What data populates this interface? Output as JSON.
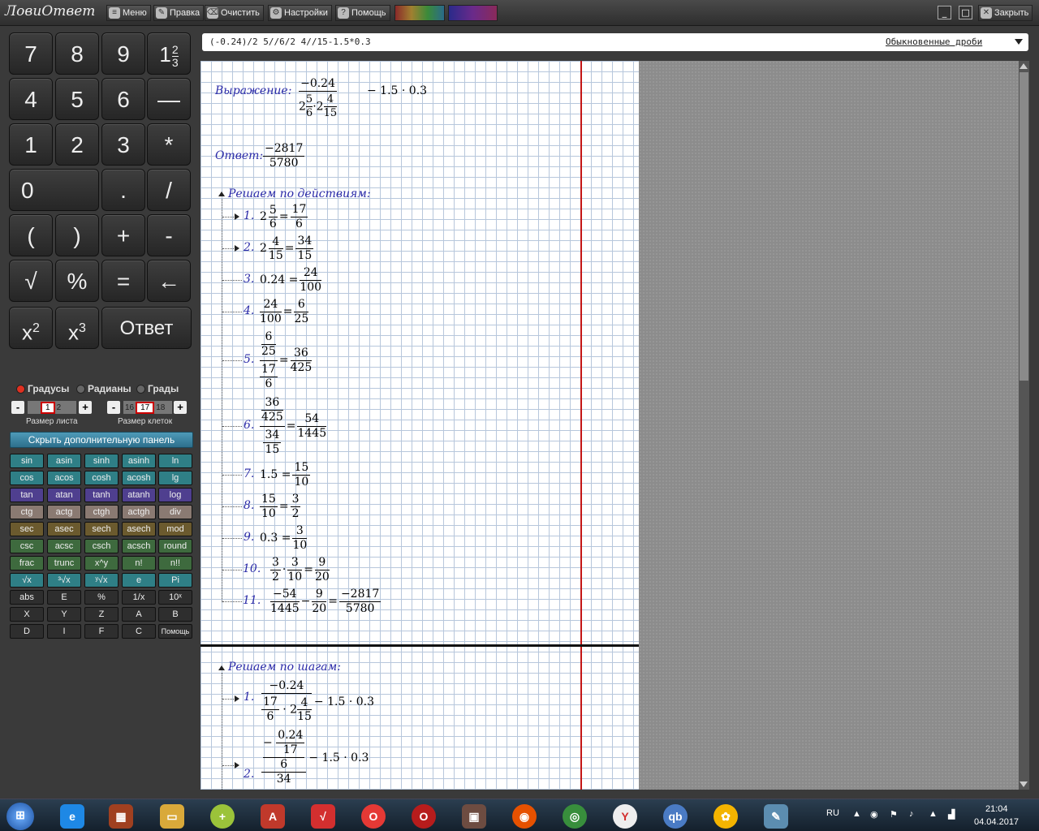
{
  "app": {
    "logo": "ЛовиОтвет",
    "menu": "Меню",
    "edit": "Правка",
    "clear": "Очистить",
    "settings": "Настройки",
    "help": "Помощь",
    "close": "Закрыть"
  },
  "keys": [
    "7",
    "8",
    "9",
    "4",
    "5",
    "6",
    "—",
    "1",
    "2",
    "3",
    "*",
    "0",
    ".",
    "/",
    "(",
    ")",
    "+",
    "-",
    "√",
    "%",
    "=",
    "←",
    "Ответ"
  ],
  "mixed_key": {
    "whole": "1",
    "num": "2",
    "den": "3"
  },
  "pow_keys": [
    {
      "base": "x",
      "exp": "2"
    },
    {
      "base": "x",
      "exp": "3"
    }
  ],
  "angle_modes": [
    "Градусы",
    "Радианы",
    "Грады"
  ],
  "sheet_size": {
    "label": "Размер листа",
    "prev": "",
    "value": "1",
    "next": "2"
  },
  "cell_size": {
    "label": "Размер клеток",
    "prev": "16",
    "value": "17",
    "next": "18"
  },
  "hide_panel": "Скрыть дополнительную панель",
  "func_keys": [
    [
      "sin",
      "asin",
      "sinh",
      "asinh",
      "ln"
    ],
    [
      "cos",
      "acos",
      "cosh",
      "acosh",
      "lg"
    ],
    [
      "tan",
      "atan",
      "tanh",
      "atanh",
      "log"
    ],
    [
      "ctg",
      "actg",
      "ctgh",
      "actgh",
      "div"
    ],
    [
      "sec",
      "asec",
      "sech",
      "asech",
      "mod"
    ],
    [
      "csc",
      "acsc",
      "csch",
      "acsch",
      "round"
    ],
    [
      "frac",
      "trunc",
      "x^y",
      "n!",
      "n!!"
    ],
    [
      "√x",
      "³√x",
      "ʸ√x",
      "e",
      "Pi"
    ],
    [
      "abs",
      "E",
      "%",
      "1/x",
      "10ˣ"
    ],
    [
      "X",
      "Y",
      "Z",
      "A",
      "B"
    ],
    [
      "D",
      "I",
      "F",
      "C",
      "Помощь"
    ]
  ],
  "func_colors": [
    "#2f7f86",
    "#2f7f86",
    "#4f3f8f",
    "#8a7a72",
    "#6b5a2e",
    "#3e6a3e",
    "#3e6a3e",
    "#2f7f86",
    "#2e2e2e",
    "#2e2e2e",
    "#2e2e2e"
  ],
  "input": {
    "expression": "(-0.24)/2 5//6/2 4//15-1.5*0.3",
    "mode": "Обыкновенные дроби"
  },
  "work": {
    "expr_label": "Выражение:",
    "answer_label": "Ответ:",
    "actions_label": "Решаем по действиям:",
    "steps_label": "Решаем по шагам:",
    "mult": "·",
    "minus_tail": "− 1.5 · 0.3",
    "eq": "=",
    "minus": "−"
  },
  "actions": [
    {
      "n": "1.",
      "expand": true
    },
    {
      "n": "2.",
      "expand": true
    },
    {
      "n": "3."
    },
    {
      "n": "4."
    },
    {
      "n": "5."
    },
    {
      "n": "6."
    },
    {
      "n": "7."
    },
    {
      "n": "8."
    },
    {
      "n": "9."
    },
    {
      "n": "10."
    },
    {
      "n": "11."
    }
  ],
  "steps": [
    {
      "n": "1.",
      "expand": true
    },
    {
      "n": "2.",
      "expand": true
    }
  ],
  "taskbar": {
    "lang": "RU",
    "time": "21:04",
    "date": "04.04.2017"
  }
}
